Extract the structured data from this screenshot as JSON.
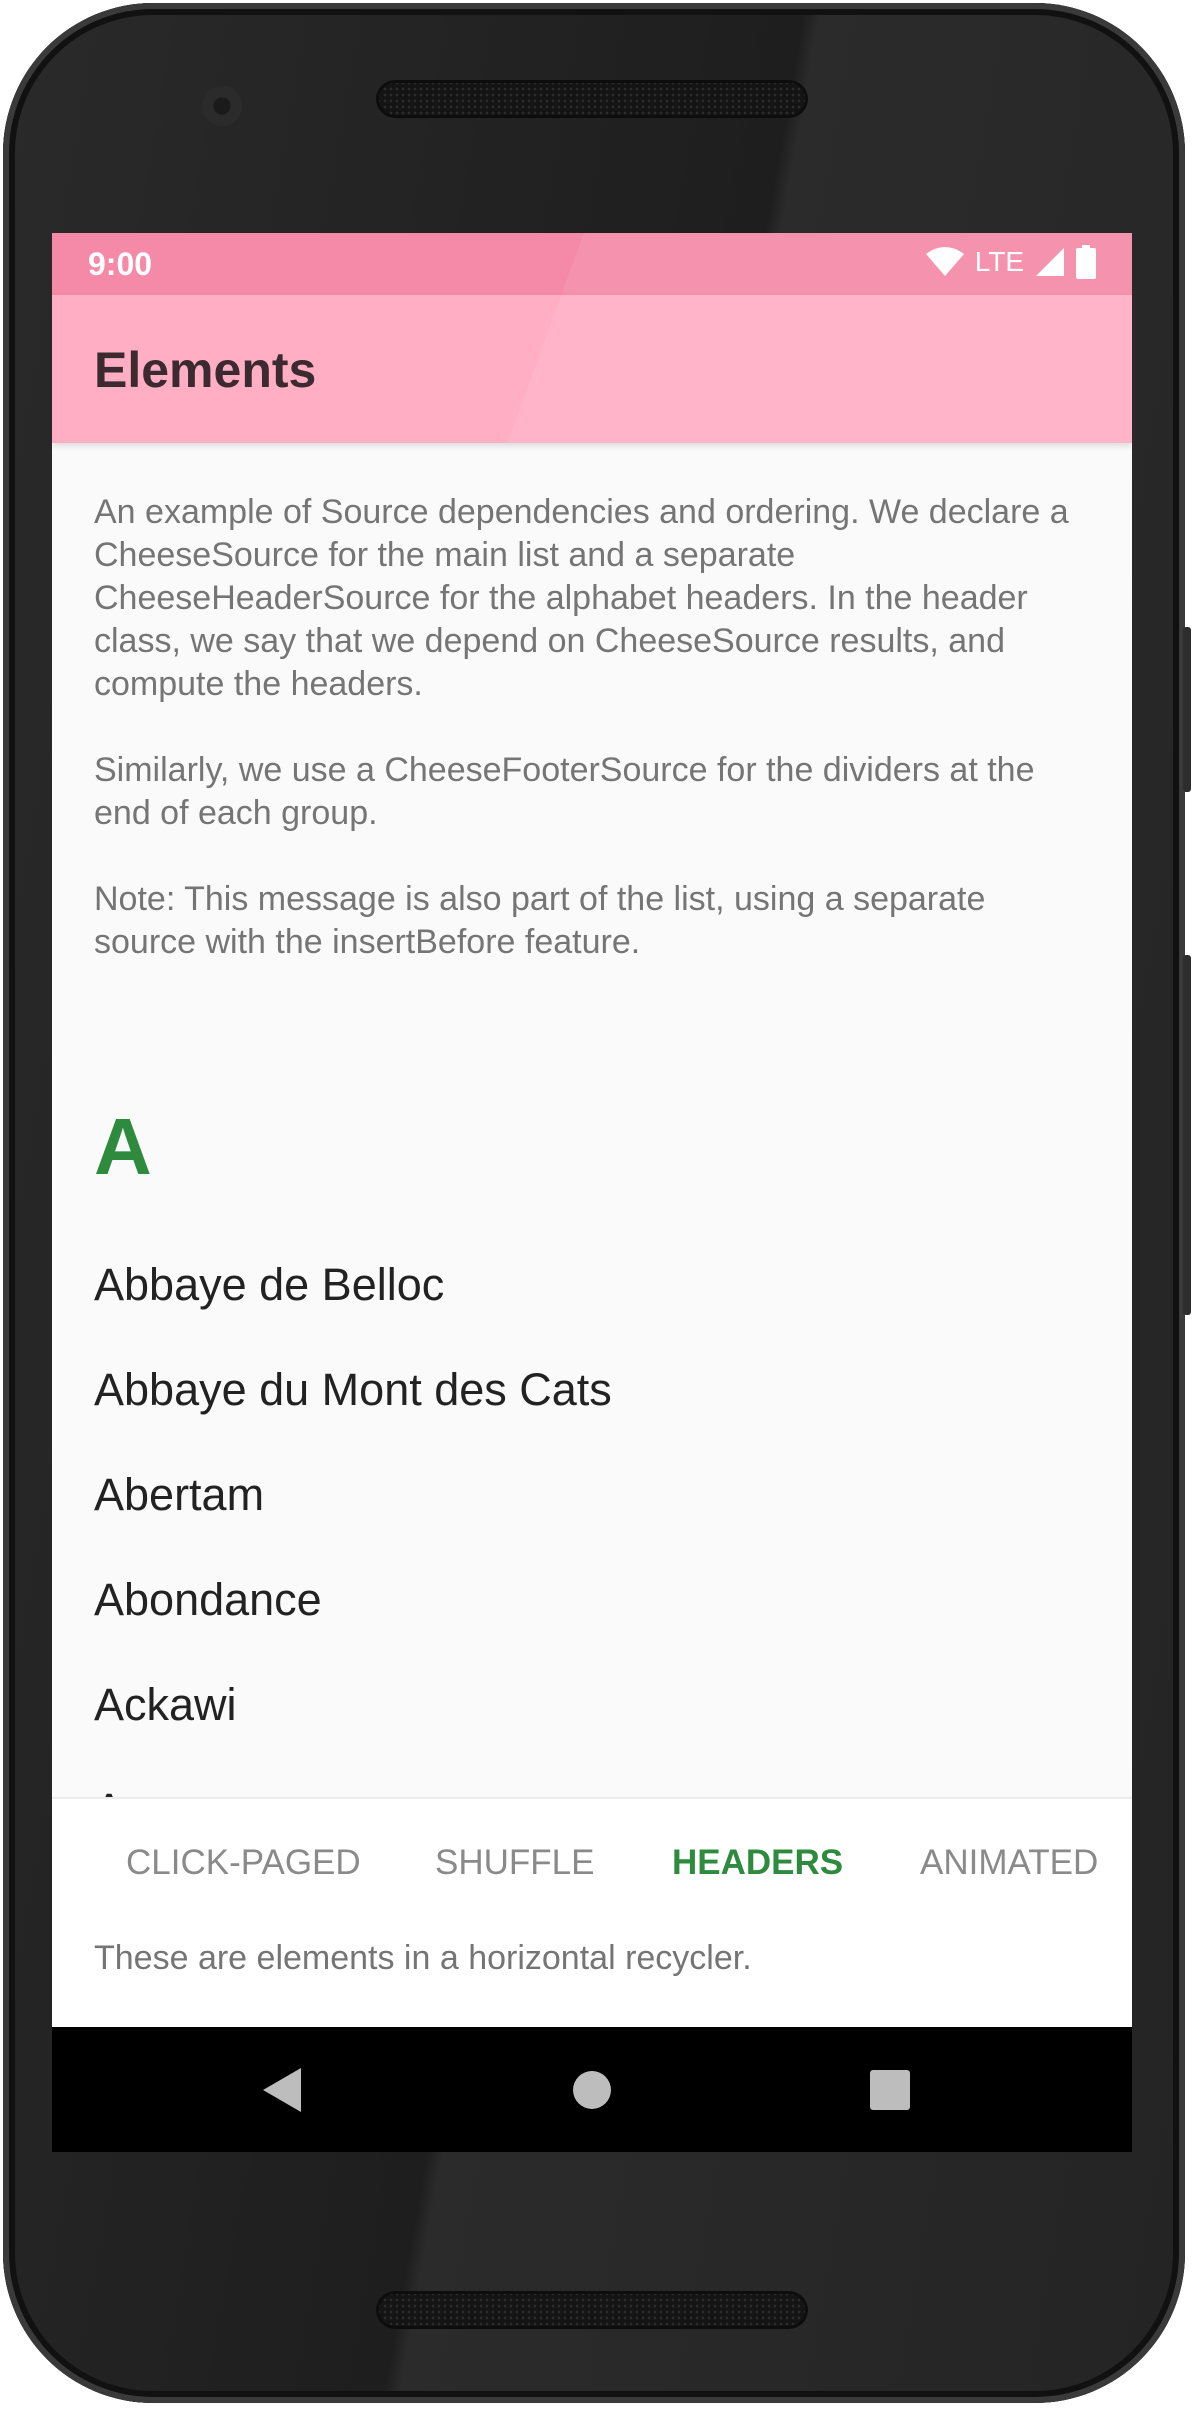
{
  "status_bar": {
    "time": "9:00",
    "network": "LTE",
    "icons": [
      "wifi-icon",
      "signal-icon",
      "battery-icon"
    ]
  },
  "app_bar": {
    "title": "Elements"
  },
  "intro": {
    "p1": "An example of Source dependencies and ordering. We declare a CheeseSource for the main list and a separate CheeseHeaderSource for the alphabet headers. In the header class, we say that we depend on CheeseSource results, and compute the headers.",
    "p2": "Similarly, we use a CheeseFooterSource for the dividers at the end of each group.",
    "p3": "Note: This message is also part of the list, using a separate source with the insertBefore feature."
  },
  "section": {
    "header": "A",
    "items": [
      "Abbaye de Belloc",
      "Abbaye du Mont des Cats",
      "Abertam",
      "Abondance",
      "Ackawi",
      "Acorn"
    ]
  },
  "tabs": [
    {
      "label": "CLICK-PAGED",
      "active": false
    },
    {
      "label": "SHUFFLE",
      "active": false
    },
    {
      "label": "HEADERS",
      "active": true
    },
    {
      "label": "ANIMATED",
      "active": false
    }
  ],
  "caption": "These are elements in a horizontal recycler.",
  "nav": {
    "back": "back-icon",
    "home": "home-icon",
    "recents": "recents-icon"
  },
  "colors": {
    "accent": "#2e8b3e",
    "app_bar": "#ffaec4",
    "status_bar": "#f48aa8"
  }
}
